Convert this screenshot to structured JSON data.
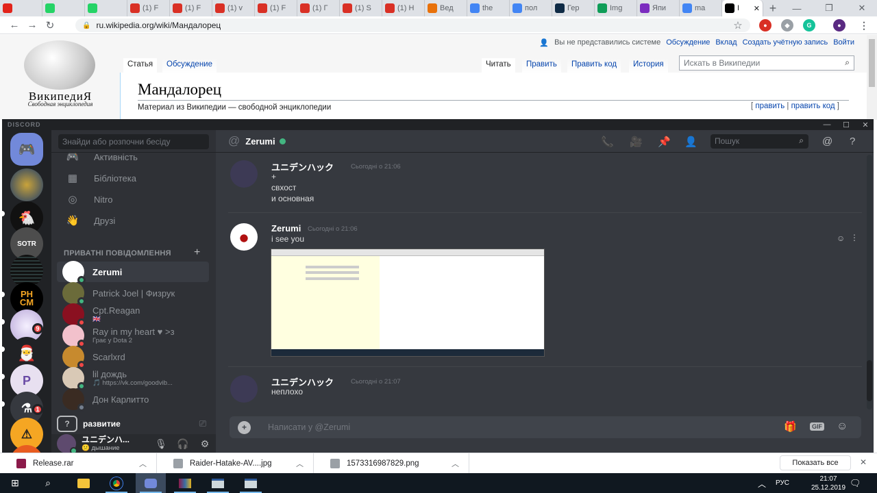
{
  "browser": {
    "tabs": [
      {
        "label": "",
        "icon": "adobe-icon",
        "color": "#e2231a"
      },
      {
        "label": "",
        "icon": "whatsapp-icon",
        "color": "#25d366"
      },
      {
        "label": "",
        "icon": "whatsapp-icon",
        "color": "#25d366"
      },
      {
        "label": "(1) F",
        "icon": "heart-icon",
        "color": "#d93025"
      },
      {
        "label": "(1) F",
        "icon": "heart-icon",
        "color": "#d93025"
      },
      {
        "label": "(1) v",
        "icon": "heart-icon",
        "color": "#d93025"
      },
      {
        "label": "(1) F",
        "icon": "heart-icon",
        "color": "#d93025"
      },
      {
        "label": "(1) Г",
        "icon": "heart-icon",
        "color": "#d93025"
      },
      {
        "label": "(1) S",
        "icon": "heart-icon",
        "color": "#d93025"
      },
      {
        "label": "(1) H",
        "icon": "heart-icon",
        "color": "#d93025"
      },
      {
        "label": "Вед",
        "icon": "star-icon",
        "color": "#e8710a"
      },
      {
        "label": "the",
        "icon": "google-icon",
        "color": "#4285f4"
      },
      {
        "label": "пол",
        "icon": "google-icon",
        "color": "#4285f4"
      },
      {
        "label": "Гер",
        "icon": "deepl-icon",
        "color": "#0f2b46"
      },
      {
        "label": "Img",
        "icon": "image-icon",
        "color": "#0f9d58"
      },
      {
        "label": "Япи",
        "icon": "yandex-icon",
        "color": "#7b2cbf"
      },
      {
        "label": "ma",
        "icon": "google-icon",
        "color": "#4285f4"
      },
      {
        "label": "I",
        "icon": "wikipedia-icon",
        "color": "#000000",
        "active": true
      }
    ],
    "close_tab": "✕",
    "new_tab": "+",
    "url": "ru.wikipedia.org/wiki/Мандалорец"
  },
  "wiki": {
    "logo_title": "ВикипедиЯ",
    "logo_sub": "Свободная энциклопедия",
    "personal": [
      "Вы не представились системе",
      "Обсуждение",
      "Вклад",
      "Создать учётную запись",
      "Войти"
    ],
    "tab_article": "Статья",
    "tab_talk": "Обсуждение",
    "tab_read": "Читать",
    "tab_edit": "Править",
    "tab_editsrc": "Править код",
    "tab_history": "История",
    "search_placeholder": "Искать в Википедии",
    "heading": "Мандалорец",
    "from": "Материал из Википедии — свободной энциклопедии",
    "edit_open": "[ ",
    "edit_link": "править",
    "edit_sep": " | ",
    "edit_src_link": "править код",
    "edit_close": " ]"
  },
  "discord": {
    "brand": "DISCORD",
    "search_dm": "Знайди або розпочни бесіду",
    "nav": [
      {
        "label": "Активність",
        "icon": "gamepad-icon"
      },
      {
        "label": "Бібліотека",
        "icon": "library-icon"
      },
      {
        "label": "Nitro",
        "icon": "nitro-icon"
      },
      {
        "label": "Друзі",
        "icon": "friends-icon"
      }
    ],
    "dm_header": "ПРИВАТНІ ПОВІДОМЛЕННЯ",
    "dm_add": "+",
    "dms": [
      {
        "name": "Zerumi",
        "sub": "",
        "status": "#43b581",
        "avatar": "#ffffff",
        "selected": true
      },
      {
        "name": "Patrick Joel | Физрук",
        "sub": "",
        "status": "#43b581",
        "avatar": "#6b6b3a"
      },
      {
        "name": "Cpt.Reagan",
        "sub": "🇬🇧",
        "status": "#f04747",
        "avatar": "#8a1020"
      },
      {
        "name": "Ray in my heart ♥ >з",
        "sub": "Грає у Dota 2",
        "status": "#f04747",
        "avatar": "#f2c1cc"
      },
      {
        "name": "Scarlxrd",
        "sub": "",
        "status": "#f04747",
        "avatar": "#c78a2e"
      },
      {
        "name": "lil дождь",
        "sub": "🎵 https://vk.com/goodvib...",
        "status": "#43b581",
        "avatar": "#d9c9b6"
      },
      {
        "name": "Дон Карлитто",
        "sub": "",
        "status": "#747f8d",
        "avatar": "#3a2b22"
      }
    ],
    "voice_channel": "развитие",
    "voice_icon": "?",
    "username": "ユニデンハ...",
    "user_status": "😕 дышание",
    "chat_title": "Zerumi",
    "header_search": "Пошук",
    "messages": [
      {
        "author": "ユニデンハック",
        "time": "Сьогодні о 21:06",
        "lines": [
          "+",
          "свхост",
          "и основная"
        ]
      },
      {
        "author": "Zerumi",
        "time": "Сьогодні о 21:06",
        "lines": [
          "i see you"
        ]
      },
      {
        "author": "ユニデンハック",
        "time": "Сьогодні о 21:07",
        "lines": [
          "неплохо"
        ]
      }
    ],
    "composer_placeholder": "Написати у @Zerumi",
    "gif_label": "GIF",
    "guild_badges": [
      "9",
      "1"
    ]
  },
  "downloads": {
    "items": [
      "Release.rar",
      "Raider-Hatake-AV....jpg",
      "1573316987829.png"
    ],
    "show_all": "Показать все",
    "close": "✕"
  },
  "taskbar": {
    "lang": "РУС",
    "time": "21:07",
    "date": "25.12.2019"
  }
}
